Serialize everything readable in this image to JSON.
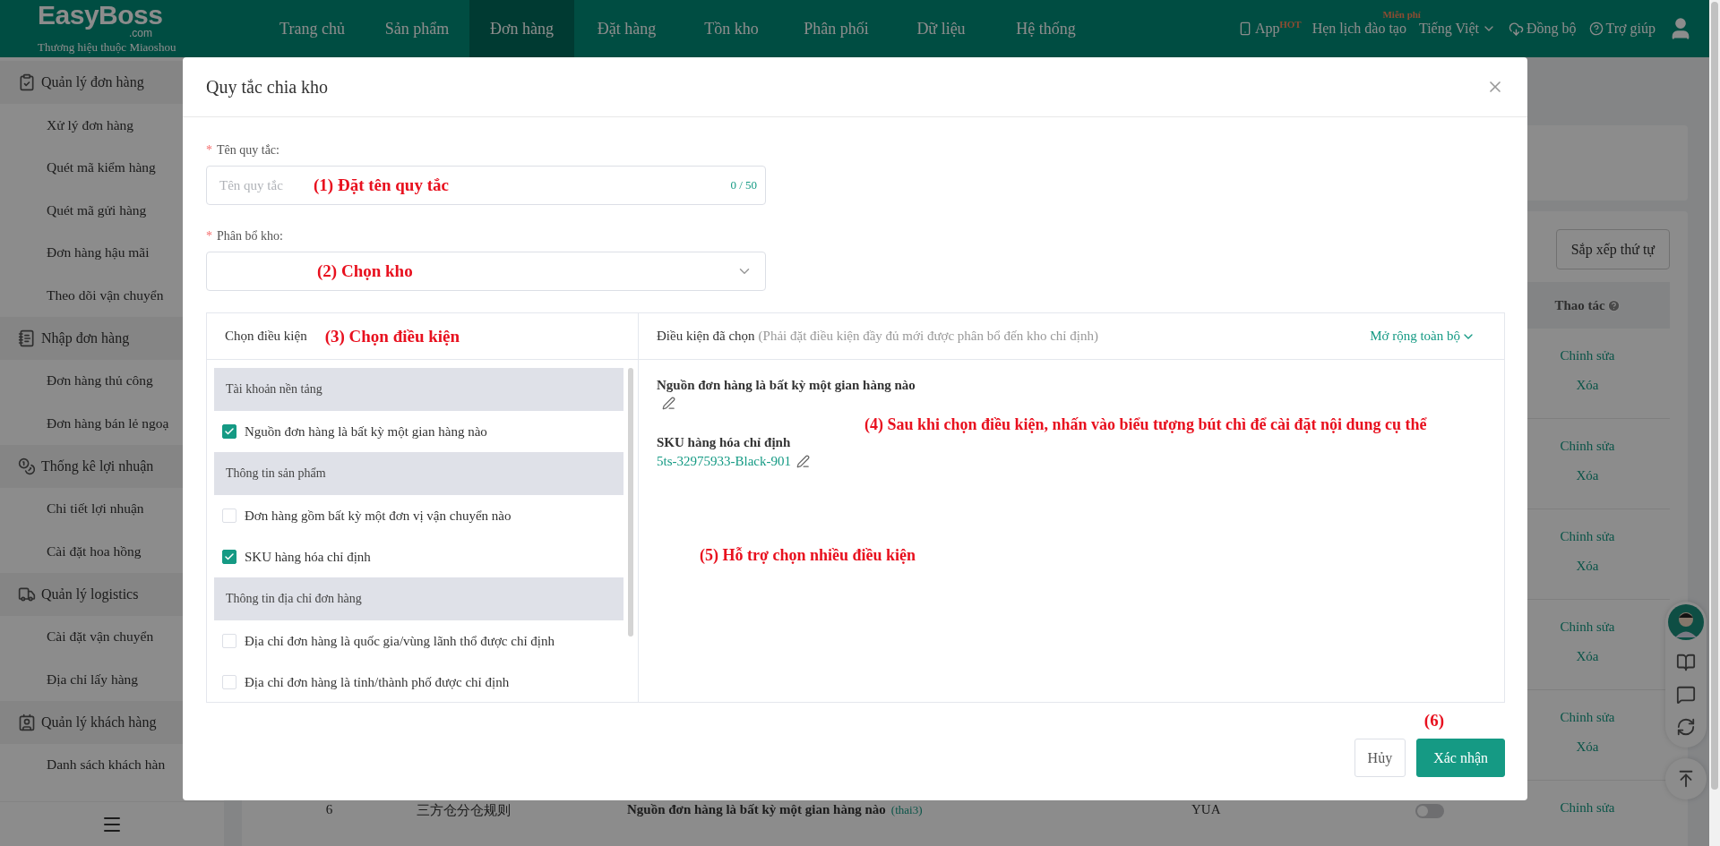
{
  "brand": {
    "logo": "EasyBoss",
    "suffix": ".com",
    "tagline": "Thương hiệu thuộc Miaoshou"
  },
  "nav": [
    {
      "label": "Trang chủ",
      "selected": false
    },
    {
      "label": "Sản phẩm",
      "selected": false
    },
    {
      "label": "Đơn hàng",
      "selected": true
    },
    {
      "label": "Đặt hàng",
      "selected": false
    },
    {
      "label": "Tồn kho",
      "selected": false
    },
    {
      "label": "Phân phối",
      "selected": false
    },
    {
      "label": "Dữ liệu",
      "selected": false
    },
    {
      "label": "Hệ thống",
      "selected": false
    }
  ],
  "header_actions": [
    {
      "kind": "app",
      "label": "App",
      "badge": "HOT"
    },
    {
      "kind": "training",
      "label": "Hẹn lịch đào tạo",
      "badge": "Miễn phí"
    },
    {
      "kind": "language",
      "label": "Tiếng Việt"
    },
    {
      "kind": "sync",
      "label": "Đồng bộ"
    },
    {
      "kind": "help",
      "label": "Trợ giúp"
    },
    {
      "kind": "user"
    }
  ],
  "sidebar": {
    "groups": [
      {
        "label": "Quản lý đơn hàng",
        "items": [
          "Xử lý đơn hàng",
          "Quét mã kiểm hàng",
          "Quét mã gửi hàng",
          "Đơn hàng hậu mãi",
          "Theo dõi vận chuyển"
        ]
      },
      {
        "label": "Nhập đơn hàng",
        "items": [
          "Đơn hàng thủ công",
          "Đơn hàng bán lẻ ngoạ"
        ]
      },
      {
        "label": "Thống kê lợi nhuận",
        "items": [
          "Chi tiết lợi nhuận",
          "Cài đặt hoa hồng"
        ]
      },
      {
        "label": "Quản lý logistics",
        "items": [
          "Cài đặt vận chuyển",
          "Địa chỉ lấy hàng"
        ]
      },
      {
        "label": "Quản lý khách hàng",
        "items": [
          "Danh sách khách hàn"
        ]
      }
    ]
  },
  "page": {
    "sort_button": "Sắp xếp thứ tự",
    "action_column": "Thao tác",
    "rows": [
      {
        "actions": [
          "Chỉnh sửa",
          "Xóa"
        ]
      },
      {
        "actions": [
          "Chỉnh sửa",
          "Xóa"
        ]
      },
      {
        "actions": [
          "Chỉnh sửa",
          "Xóa"
        ]
      },
      {
        "actions": [
          "Chỉnh sửa",
          "Xóa"
        ]
      },
      {
        "actions": [
          "Chỉnh sửa",
          "Xóa"
        ]
      },
      {
        "index": "6",
        "name": "三方仓分仓规则",
        "rule": "Nguồn đơn hàng là bất kỳ một gian hàng nào",
        "tag": "(thai3)",
        "warehouse": "YUA",
        "enabled": false,
        "actions": [
          "Chỉnh sửa"
        ]
      }
    ]
  },
  "dialog": {
    "title": "Quy tắc chia kho",
    "name_field": {
      "required_mark": "*",
      "label": "Tên quy tắc:",
      "placeholder": "Tên quy tắc",
      "counter": "0 / 50",
      "annotation": "(1) Đặt tên quy tắc"
    },
    "warehouse_field": {
      "required_mark": "*",
      "label": "Phân bổ kho:",
      "annotation": "(2) Chọn kho"
    },
    "conditions": {
      "title": "Chọn điều kiện",
      "annotation": "(3) Chọn điều kiện",
      "groups": [
        {
          "label": "Tài khoản nền tảng",
          "items": [
            {
              "label": "Nguồn đơn hàng là bất kỳ một gian hàng nào",
              "checked": true
            }
          ]
        },
        {
          "label": "Thông tin sản phẩm",
          "items": [
            {
              "label": "Đơn hàng gồm bất kỳ một đơn vị vận chuyển nào",
              "checked": false
            },
            {
              "label": "SKU hàng hóa chỉ định",
              "checked": true
            }
          ]
        },
        {
          "label": "Thông tin địa chỉ đơn hàng",
          "items": [
            {
              "label": "Địa chỉ đơn hàng là quốc gia/vùng lãnh thổ được chỉ định",
              "checked": false
            },
            {
              "label": "Địa chỉ đơn hàng là tỉnh/thành phố được chỉ định",
              "checked": false
            }
          ]
        }
      ]
    },
    "selected": {
      "title": "Điều kiện đã chọn",
      "hint": "(Phải đặt điều kiện đầy đủ mới được phân bổ đến kho chỉ định)",
      "expand": "Mở rộng toàn bộ",
      "items": [
        {
          "title": "Nguồn đơn hàng là bất kỳ một gian hàng nào"
        },
        {
          "title": "SKU hàng hóa chỉ định",
          "value": "5ts-32975933-Black-901"
        }
      ],
      "annotations": [
        "(4) Sau khi chọn điều kiện, nhấn vào biểu tượng bút chì để cài đặt nội dung cụ thể",
        "(5) Hỗ trợ chọn nhiều điều kiện"
      ]
    },
    "footer_annotation": "(6)",
    "buttons": [
      {
        "label": "Hủy",
        "kind": "secondary"
      },
      {
        "label": "Xác nhận",
        "kind": "primary"
      }
    ]
  }
}
